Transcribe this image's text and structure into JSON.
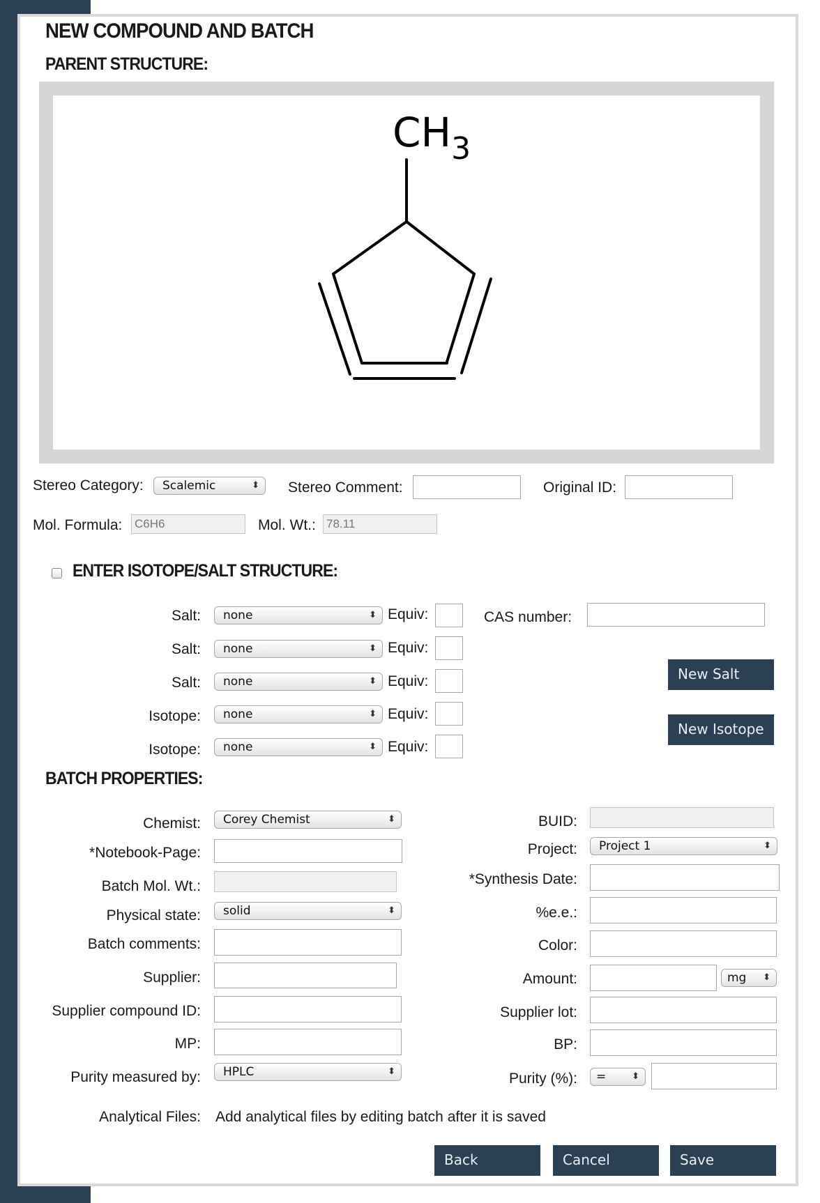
{
  "page": {
    "title": "NEW COMPOUND AND BATCH",
    "parent_structure_heading": "PARENT STRUCTURE:",
    "structure_labels": {
      "ch": "CH",
      "sub": "3"
    }
  },
  "stereo": {
    "category_label": "Stereo Category:",
    "category_value": "Scalemic",
    "comment_label": "Stereo Comment:",
    "comment_value": "",
    "original_id_label": "Original ID:",
    "original_id_value": ""
  },
  "mol": {
    "formula_label": "Mol. Formula:",
    "formula_value": "C6H6",
    "weight_label": "Mol. Wt.:",
    "weight_value": "78.11"
  },
  "isotope_salt": {
    "heading": "ENTER ISOTOPE/SALT STRUCTURE:",
    "checked": false,
    "equiv_label": "Equiv:",
    "rows": [
      {
        "label": "Salt:",
        "value": "none"
      },
      {
        "label": "Salt:",
        "value": "none"
      },
      {
        "label": "Salt:",
        "value": "none"
      },
      {
        "label": "Isotope:",
        "value": "none"
      },
      {
        "label": "Isotope:",
        "value": "none"
      }
    ],
    "cas_label": "CAS number:",
    "cas_value": "",
    "new_salt_button": "New Salt",
    "new_isotope_button": "New Isotope"
  },
  "batch": {
    "heading": "BATCH PROPERTIES:",
    "left": {
      "chemist_label": "Chemist:",
      "chemist_value": "Corey Chemist",
      "notebook_label": "*Notebook-Page:",
      "notebook_value": "",
      "batch_mw_label": "Batch Mol. Wt.:",
      "batch_mw_value": "",
      "physical_label": "Physical state:",
      "physical_value": "solid",
      "comments_label": "Batch comments:",
      "comments_value": "",
      "supplier_label": "Supplier:",
      "supplier_value": "",
      "supplier_cid_label": "Supplier compound ID:",
      "supplier_cid_value": "",
      "mp_label": "MP:",
      "mp_value": "",
      "purity_by_label": "Purity measured by:",
      "purity_by_value": "HPLC"
    },
    "right": {
      "buid_label": "BUID:",
      "buid_value": "",
      "project_label": "Project:",
      "project_value": "Project 1",
      "synthesis_label": "*Synthesis Date:",
      "synthesis_value": "",
      "ee_label": "%e.e.:",
      "ee_value": "",
      "color_label": "Color:",
      "color_value": "",
      "amount_label": "Amount:",
      "amount_value": "",
      "amount_unit": "mg",
      "supplier_lot_label": "Supplier lot:",
      "supplier_lot_value": "",
      "bp_label": "BP:",
      "bp_value": "",
      "purity_label": "Purity (%):",
      "purity_op": "=",
      "purity_value": ""
    },
    "analytical_label": "Analytical Files:",
    "analytical_text": "Add analytical files by editing batch after it is saved"
  },
  "footer": {
    "back": "Back",
    "cancel": "Cancel",
    "save": "Save"
  },
  "colors": {
    "sidebar": "#2b4052",
    "button_bg": "#2b4052",
    "panel_border": "#d9d9d9",
    "structure_frame": "#d6d6d6"
  }
}
